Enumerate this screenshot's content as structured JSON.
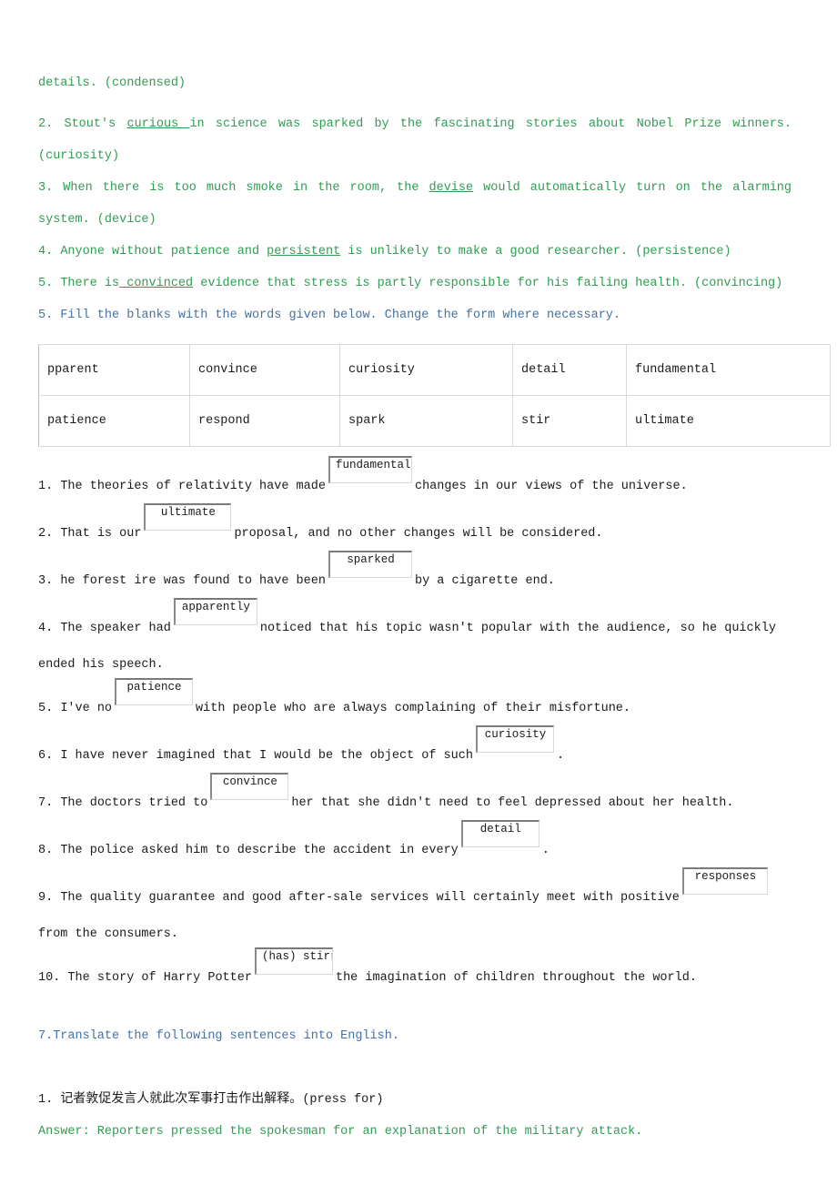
{
  "doc": {
    "intro_fragment": "details. (condensed)",
    "correction_items": [
      {
        "num": "2.",
        "pre": "Stout's ",
        "underlined": "curious ",
        "post": "in science was sparked by the fascinating stories about Nobel Prize winners. (curiosity)"
      },
      {
        "num": "3.",
        "pre": "When there is too much smoke in the room, the ",
        "underlined": "devise",
        "post": " would automatically turn on the alarming system. (device)"
      },
      {
        "num": "4.",
        "pre": "Anyone without patience and ",
        "underlined": "persistent",
        "post": " is unlikely to make a good researcher. (persistence)"
      },
      {
        "num": "5.",
        "pre": "There is",
        "underlined": " convinced",
        "post": " evidence that stress is partly responsible for his failing health. (convincing)"
      }
    ],
    "section_fill": {
      "heading": "5. Fill the blanks with the words given below. Change the form where necessary.",
      "wordbank": [
        [
          "pparent",
          "convince",
          "curiosity",
          "detail",
          "fundamental"
        ],
        [
          "patience",
          "respond",
          "spark",
          "stir",
          "ultimate"
        ]
      ],
      "sentences": [
        {
          "num": "1.",
          "before": "The theories of relativity have made",
          "answer": "fundamental",
          "after": "changes in our views of the universe."
        },
        {
          "num": "2.",
          "before": "That is our",
          "answer": "ultimate",
          "after": "proposal, and no other changes will be considered."
        },
        {
          "num": "3.",
          "before": "he forest ire was found to have been",
          "answer": "sparked",
          "after": "by a cigarette end."
        },
        {
          "num": "4.",
          "before": "The speaker had",
          "answer": "apparently",
          "after": "noticed that his topic wasn't popular with the audience, so he quickly ended his speech."
        },
        {
          "num": "5.",
          "before": "I've no",
          "answer": "patience",
          "after": "with people who are always complaining of their misfortune."
        },
        {
          "num": "6.",
          "before": "I have never imagined that I would be the object of such",
          "answer": "curiosity",
          "after": "."
        },
        {
          "num": "7.",
          "before": "The doctors tried to",
          "answer": "convince",
          "after": "her that she didn't need to feel depressed about her health."
        },
        {
          "num": "8.",
          "before": "The police asked him to describe the accident in every",
          "answer": "detail",
          "after": "."
        },
        {
          "num": "9.",
          "before": "The quality guarantee and good after-sale services will certainly meet with positive",
          "answer": "responses",
          "after": "from the consumers."
        },
        {
          "num": "10.",
          "before": "The story of Harry Potter",
          "answer": "(has) stirred",
          "after": "the imagination of children throughout the world."
        }
      ]
    },
    "section_translate": {
      "heading": "7.Translate the following sentences into English.",
      "items": [
        {
          "num": "1.",
          "chinese": "记者敦促发言人就此次军事打击作出解释。",
          "hint": "(press for)",
          "answer": "Answer: Reporters pressed the spokesman for an explanation of the military attack."
        }
      ]
    }
  },
  "colors": {
    "green": "#2f9c52",
    "blue": "#4472a4",
    "text": "#1a1a1a",
    "table_border": "#d9d9d9",
    "box_border_dark": "#7a7a7a",
    "box_border_light": "#d8d8d8"
  }
}
